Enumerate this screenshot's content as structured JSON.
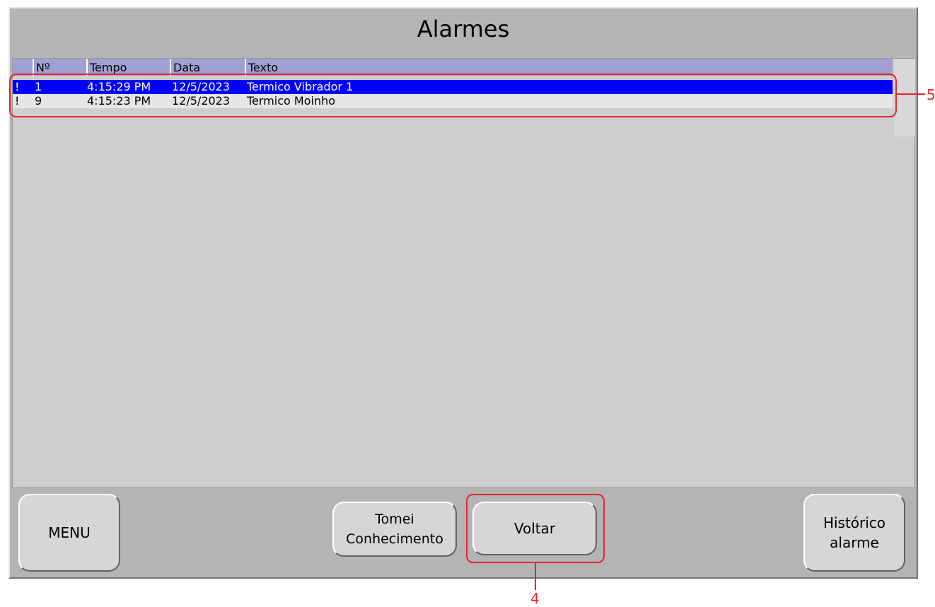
{
  "screen": {
    "title": "Alarmes"
  },
  "alarm_table": {
    "columns": [
      "Nº",
      "Tempo",
      "Data",
      "Texto"
    ],
    "rows": [
      {
        "flag": "!",
        "number": "1",
        "time": "4:15:29 PM",
        "date": "12/5/2023",
        "text": "Termico Vibrador 1",
        "selected": true
      },
      {
        "flag": "!",
        "number": "9",
        "time": "4:15:23 PM",
        "date": "12/5/2023",
        "text": "Termico Moinho",
        "selected": false
      }
    ]
  },
  "buttons": {
    "menu": "MENU",
    "acknowledge": "Tomei\nConhecimento",
    "back": "Voltar",
    "history": "Histórico\nalarme"
  },
  "annotations": {
    "table_marker": "5",
    "back_marker": "4"
  },
  "colors": {
    "header_bg": "#a0a0d2",
    "selected_row": "#0000ff",
    "panel_bg": "#b4b4b4",
    "annotation": "#e3262e"
  }
}
